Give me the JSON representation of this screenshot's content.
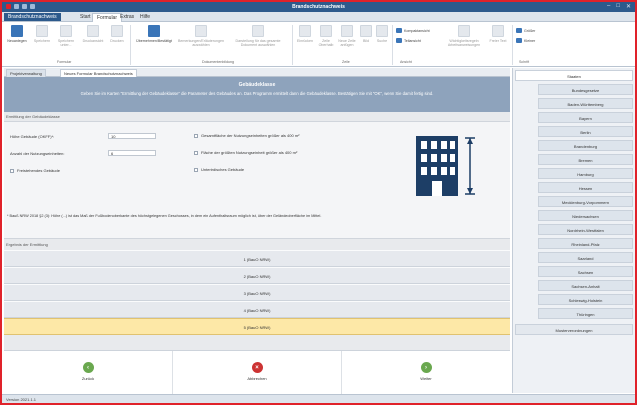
{
  "window": {
    "title": "Brandschutznachweis",
    "controls": [
      "–",
      "□",
      "✕"
    ]
  },
  "menu": {
    "app_tab": "Brandschutznachweis",
    "tabs": [
      "Start",
      "Formular",
      "Extras",
      "Hilfe"
    ],
    "active_tab": "Formular"
  },
  "ribbon": {
    "buttons": [
      {
        "label": "Neuanlegen",
        "icon": "new-document-icon"
      },
      {
        "label": "Speichern",
        "icon": "save-icon"
      },
      {
        "label": "Speichern unter...",
        "icon": "save-as-icon"
      },
      {
        "label": "Druckansicht",
        "icon": "print-preview-icon"
      },
      {
        "label": "Drucken",
        "icon": "print-icon"
      },
      {
        "label": "Übernehmen/Bestätigt",
        "icon": "confirm-icon"
      },
      {
        "label": "Bemerkungen/Erläuterungen auswählen",
        "icon": "notes-icon"
      },
      {
        "label": "Darstellung für das gesamte Dokument auswählen",
        "icon": "layout-icon"
      },
      {
        "label": "Einrücken",
        "icon": "indent-icon"
      },
      {
        "label": "Zeile Oberhalb",
        "icon": "row-above-icon"
      },
      {
        "label": "Neue Zeile anfügen",
        "icon": "row-append-icon"
      },
      {
        "label": "Bild",
        "icon": "image-icon"
      },
      {
        "label": "Suche",
        "icon": "search-icon"
      },
      {
        "label": "Wichtigkeitsregeln Arbeitsanweisungen",
        "icon": "rules-icon"
      },
      {
        "label": "Freier Text",
        "icon": "free-text-icon"
      }
    ],
    "small_buttons": [
      "Kompaktansicht",
      "Teilansicht",
      "Größer",
      "Kleiner"
    ],
    "groups": [
      "Formular",
      "Dokumentenbildung",
      "Zeile",
      "Ansicht",
      "Schrift"
    ]
  },
  "doc_tabs": [
    "Projektverwaltung",
    "Neues Formular Brandschutznachweis"
  ],
  "form": {
    "heading": "Gebäudeklasse",
    "description": "Geben Sie im Karten \"Ermittlung der Gebäudeklasse\" die Parameter des Gebäudes an. Das Programm ermittelt dann die Gebäudeklasse. Bestätigen Sie mit \"OK\", wenn Sie damit fertig sind.",
    "section_title": "Ermittlung der Gebäudeklasse",
    "fields": [
      {
        "label": "Höhe Gebäude (OKFF)*:",
        "value": "10"
      },
      {
        "label": "Anzahl der Nutzungseinheiten:",
        "value": "6"
      }
    ],
    "checkboxes": [
      "Freistehendes Gebäude",
      "Gesamtfläche der Nutzungseinheiten größer als 400 m²",
      "Fläche der größten Nutzungseinheit größer als 400 m²",
      "Unterirdisches Gebäude"
    ],
    "footnote": "* Bauß NRW 2018 §2 (3): Höhe (...) ist das Maß der Fußbodenoberkante des höchstgelegenen Geschosses, in dem ein Aufenthaltsraum möglich ist, über der Geländeoberfläche im Mittel.",
    "result_title": "Ergebnis der Ermittlung",
    "results": [
      "1 (BauO NRW)",
      "2 (BauO NRW)",
      "3 (BauO NRW)",
      "4 (BauO NRW)",
      "5 (BauO NRW)"
    ],
    "selected_result": 4
  },
  "navigation": {
    "back": "Zurück",
    "cancel": "Abbrechen",
    "next": "Weiter",
    "colors": {
      "back": "#6aa84f",
      "cancel": "#cc3333",
      "next": "#6aa84f"
    }
  },
  "sidebar": {
    "first": "Staaten",
    "items": [
      "Bundesgesetze",
      "Baden-Württemberg",
      "Bayern",
      "Berlin",
      "Brandenburg",
      "Bremen",
      "Hamburg",
      "Hessen",
      "Mecklenburg-Vorpommern",
      "Niedersachsen",
      "Nordrhein-Westfalen",
      "Rheinland-Pfalz",
      "Saarland",
      "Sachsen",
      "Sachsen-Anhalt",
      "Schleswig-Holstein",
      "Thüringen"
    ],
    "last": "Musterverordnungen"
  },
  "status": {
    "text": "Version 2021.1.1"
  }
}
